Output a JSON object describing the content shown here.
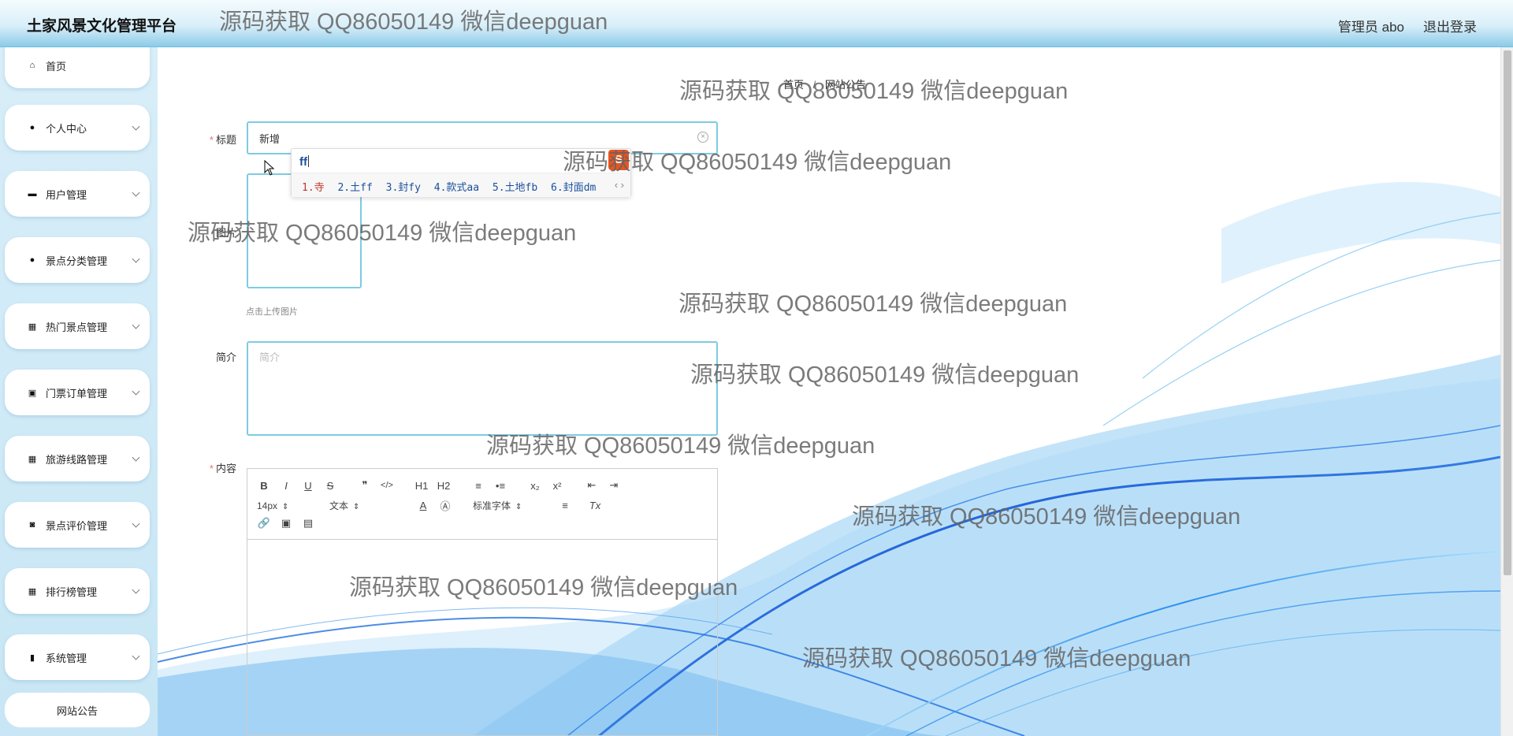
{
  "app": {
    "title": "土家风景文化管理平台"
  },
  "header": {
    "user_label": "管理员 abo",
    "logout_label": "退出登录"
  },
  "sidebar": {
    "items": [
      {
        "label": "首页",
        "icon": "home-icon",
        "expandable": false
      },
      {
        "label": "个人中心",
        "icon": "user-icon",
        "expandable": true
      },
      {
        "label": "用户管理",
        "icon": "chat-icon",
        "expandable": true
      },
      {
        "label": "景点分类管理",
        "icon": "user-icon",
        "expandable": true
      },
      {
        "label": "热门景点管理",
        "icon": "grid-icon",
        "expandable": true
      },
      {
        "label": "门票订单管理",
        "icon": "printer-icon",
        "expandable": true
      },
      {
        "label": "旅游线路管理",
        "icon": "grid-icon",
        "expandable": true
      },
      {
        "label": "景点评价管理",
        "icon": "ticket-icon",
        "expandable": true
      },
      {
        "label": "排行榜管理",
        "icon": "grid-icon",
        "expandable": true
      },
      {
        "label": "系统管理",
        "icon": "chart-icon",
        "expandable": true
      }
    ],
    "submenu": {
      "label": "网站公告"
    }
  },
  "breadcrumb": {
    "home": "首页",
    "separator": "/",
    "current": "网站公告"
  },
  "form": {
    "title_label": "标题",
    "title_value": "新增",
    "image_label": "图片",
    "upload_hint": "点击上传图片",
    "summary_label": "简介",
    "summary_placeholder": "简介",
    "content_label": "内容"
  },
  "ime": {
    "input": "ff",
    "candidates": [
      "1.寺",
      "2.土ff",
      "3.封fy",
      "4.款式aa",
      "5.土地fb",
      "6.封面dm"
    ],
    "nav": "‹ ›",
    "logo": "S"
  },
  "editor": {
    "toolbar_row1": [
      "B",
      "I",
      "U",
      "S",
      "❞",
      "</>",
      "H1",
      "H2",
      "≡",
      "•≡",
      "x₂",
      "x²",
      "⇤",
      "⇥"
    ],
    "font_size": "14px",
    "header_select": "文本",
    "font_family": "标准字体",
    "toolbar_row2_extra": [
      "A",
      "Ⓐ",
      "≡",
      "Tx"
    ],
    "toolbar_row3": [
      "🔗",
      "▣",
      "▤"
    ]
  },
  "watermark": {
    "text": "源码获取 QQ86050149 微信deepguan"
  }
}
